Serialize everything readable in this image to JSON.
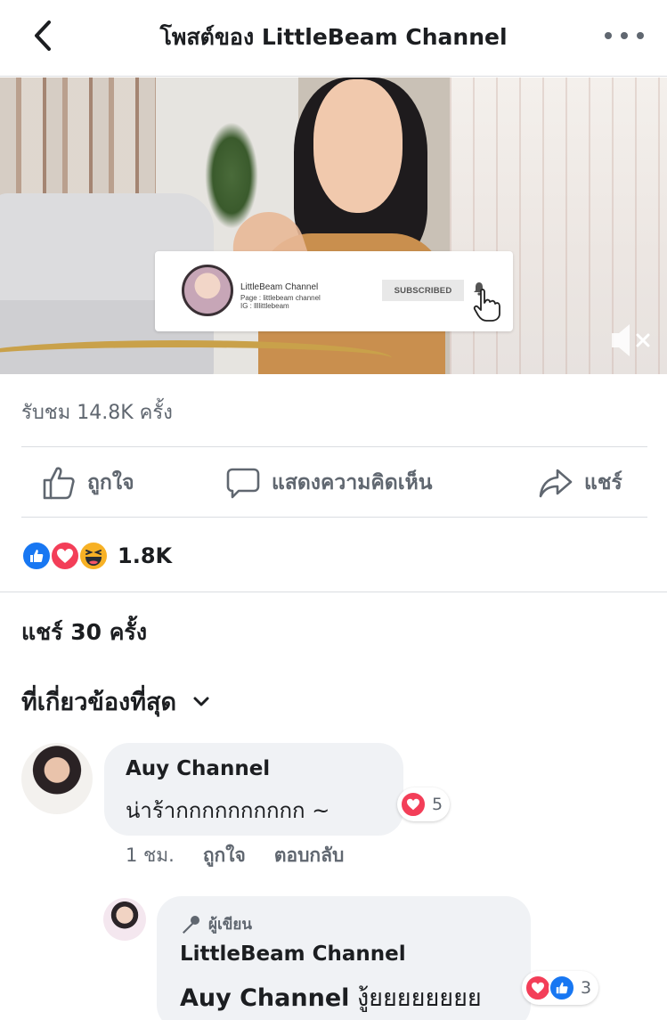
{
  "header": {
    "title": "โพสต์ของ LittleBeam Channel",
    "back_icon": "chevron-left-icon",
    "more_icon": "more-horizontal-icon"
  },
  "video": {
    "overlay_card": {
      "channel_name": "LittleBeam Channel",
      "page_line": "Page : littlebeam channel",
      "ig_line": "IG : llllittlebeam",
      "subscribe_label": "SUBSCRIBED"
    },
    "muted": true
  },
  "stats": {
    "views": "รับชม 14.8K ครั้ง"
  },
  "actions": {
    "like_label": "ถูกใจ",
    "comment_label": "แสดงความคิดเห็น",
    "share_label": "แชร์"
  },
  "reactions": {
    "types": [
      "like",
      "love",
      "haha"
    ],
    "count": "1.8K"
  },
  "shares": "แชร์ 30 ครั้ง",
  "sort": {
    "label": "ที่เกี่ยวข้องที่สุด"
  },
  "comments": [
    {
      "author": "Auy Channel",
      "text": "น่าร้ากกกกกกกกกก ~",
      "reaction_types": [
        "love"
      ],
      "reaction_count": "5",
      "time": "1 ชม.",
      "like_label": "ถูกใจ",
      "reply_label": "ตอบกลับ",
      "reply": {
        "badge": "ผู้เขียน",
        "author": "LittleBeam Channel",
        "tag": "Auy Channel",
        "text": "งู้ยยยยยยยย",
        "reaction_types": [
          "love",
          "like"
        ],
        "reaction_count": "3"
      }
    }
  ],
  "colors": {
    "like_blue": "#1877f2",
    "love_red": "#f33e58",
    "haha_yellow": "#f7b125",
    "secondary_text": "#606770",
    "bubble_bg": "#f0f2f5"
  }
}
